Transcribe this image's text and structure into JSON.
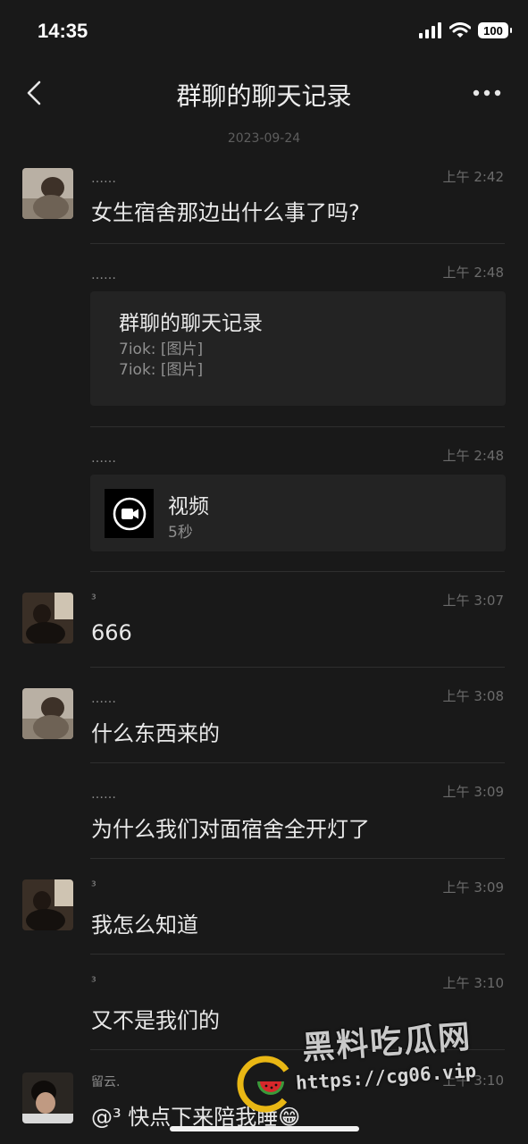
{
  "status_bar": {
    "time": "14:35",
    "battery": "100"
  },
  "nav": {
    "title": "群聊的聊天记录"
  },
  "date_separator": "2023-09-24",
  "messages": [
    {
      "sender": "……",
      "time": "上午 2:42",
      "text": "女生宿舍那边出什么事了吗?"
    },
    {
      "sender": "……",
      "time": "上午 2:48",
      "card": {
        "title": "群聊的聊天记录",
        "lines": [
          "7iok: [图片]",
          "7iok: [图片]"
        ]
      }
    },
    {
      "sender": "……",
      "time": "上午 2:48",
      "video": {
        "label": "视频",
        "duration": "5秒"
      }
    },
    {
      "sender": "³",
      "time": "上午 3:07",
      "text": "666"
    },
    {
      "sender": "……",
      "time": "上午 3:08",
      "text": "什么东西来的"
    },
    {
      "sender": "……",
      "time": "上午 3:09",
      "text": "为什么我们对面宿舍全开灯了"
    },
    {
      "sender": "³",
      "time": "上午 3:09",
      "text": "我怎么知道"
    },
    {
      "sender": "³",
      "time": "上午 3:10",
      "text": "又不是我们的"
    },
    {
      "sender": "留云.",
      "time": "上午 3:10",
      "text": "@³ 快点下来陪我睡😁"
    }
  ],
  "watermark": {
    "title": "黑料吃瓜网",
    "url": "https://cg06.vip"
  }
}
